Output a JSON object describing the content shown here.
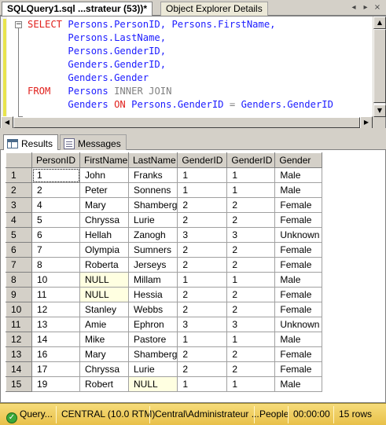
{
  "doc_tabs": {
    "active_label": "SQLQuery1.sql ...strateur (53))*",
    "inactive_label": "Object Explorer Details",
    "scroll_left_glyph": "◂",
    "scroll_right_glyph": "▸",
    "close_glyph": "×"
  },
  "editor": {
    "outline_glyph": "−"
  },
  "result_tabs": {
    "results_label": "Results",
    "messages_label": "Messages"
  },
  "grid": {
    "columns": [
      "",
      "PersonID",
      "FirstName",
      "LastName",
      "GenderID",
      "GenderID",
      "Gender"
    ],
    "rows": [
      [
        "1",
        "1",
        "John",
        "Franks",
        "1",
        "1",
        "Male"
      ],
      [
        "2",
        "2",
        "Peter",
        "Sonnens",
        "1",
        "1",
        "Male"
      ],
      [
        "3",
        "4",
        "Mary",
        "Shamberg",
        "2",
        "2",
        "Female"
      ],
      [
        "4",
        "5",
        "Chryssa",
        "Lurie",
        "2",
        "2",
        "Female"
      ],
      [
        "5",
        "6",
        "Hellah",
        "Zanogh",
        "3",
        "3",
        "Unknown"
      ],
      [
        "6",
        "7",
        "Olympia",
        "Sumners",
        "2",
        "2",
        "Female"
      ],
      [
        "7",
        "8",
        "Roberta",
        "Jerseys",
        "2",
        "2",
        "Female"
      ],
      [
        "8",
        "10",
        "NULL",
        "Millam",
        "1",
        "1",
        "Male"
      ],
      [
        "9",
        "11",
        "NULL",
        "Hessia",
        "2",
        "2",
        "Female"
      ],
      [
        "10",
        "12",
        "Stanley",
        "Webbs",
        "2",
        "2",
        "Female"
      ],
      [
        "11",
        "13",
        "Amie",
        "Ephron",
        "3",
        "3",
        "Unknown"
      ],
      [
        "12",
        "14",
        "Mike",
        "Pastore",
        "1",
        "1",
        "Male"
      ],
      [
        "13",
        "16",
        "Mary",
        "Shamberg",
        "2",
        "2",
        "Female"
      ],
      [
        "14",
        "17",
        "Chryssa",
        "Lurie",
        "2",
        "2",
        "Female"
      ],
      [
        "15",
        "19",
        "Robert",
        "NULL",
        "1",
        "1",
        "Male"
      ]
    ]
  },
  "status": {
    "state": "Query...",
    "server": "CENTRAL (10.0 RTM)",
    "user": "Central\\Administrateur ...",
    "database": "People",
    "elapsed": "00:00:00",
    "rows": "15 rows"
  },
  "colors": {
    "keyword": "#0000ff",
    "identifier": "#1c1cff",
    "red": "#e0201c",
    "gray_keyword": "#808080",
    "null_cell": "#ffffe1",
    "status_bar": "#f0cc50"
  }
}
